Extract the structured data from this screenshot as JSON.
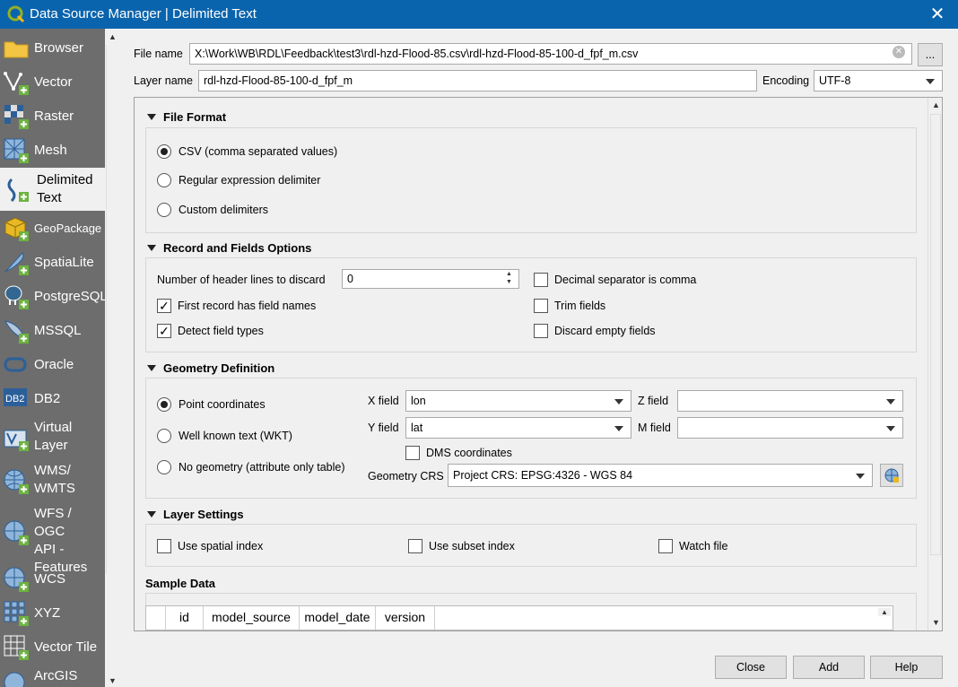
{
  "window": {
    "title": "Data Source Manager | Delimited Text"
  },
  "sidebar": {
    "items": [
      {
        "label": "Browser"
      },
      {
        "label": "Vector"
      },
      {
        "label": "Raster"
      },
      {
        "label": "Mesh"
      },
      {
        "label": "Delimited\nText"
      },
      {
        "label": "GeoPackage"
      },
      {
        "label": "SpatiaLite"
      },
      {
        "label": "PostgreSQL"
      },
      {
        "label": "MSSQL"
      },
      {
        "label": "Oracle"
      },
      {
        "label": "DB2"
      },
      {
        "label": "Virtual\nLayer"
      },
      {
        "label": "WMS/\nWMTS"
      },
      {
        "label": "WFS / OGC\nAPI -\nFeatures"
      },
      {
        "label": "WCS"
      },
      {
        "label": "XYZ"
      },
      {
        "label": "Vector Tile"
      },
      {
        "label": "ArcGIS"
      }
    ]
  },
  "file": {
    "name_label": "File name",
    "name_value": "X:\\Work\\WB\\RDL\\Feedback\\test3\\rdl-hzd-Flood-85.csv\\rdl-hzd-Flood-85-100-d_fpf_m.csv",
    "browse_label": "..."
  },
  "layer": {
    "name_label": "Layer name",
    "name_value": "rdl-hzd-Flood-85-100-d_fpf_m",
    "encoding_label": "Encoding",
    "encoding_value": "UTF-8"
  },
  "file_format": {
    "title": "File Format",
    "options": [
      "CSV (comma separated values)",
      "Regular expression delimiter",
      "Custom delimiters"
    ]
  },
  "record": {
    "title": "Record and Fields Options",
    "header_lines_label": "Number of header lines to discard",
    "header_lines_value": "0",
    "first_record": "First record has field names",
    "detect_types": "Detect field types",
    "decimal_comma": "Decimal separator is comma",
    "trim_fields": "Trim fields",
    "discard_empty": "Discard empty fields"
  },
  "geometry": {
    "title": "Geometry Definition",
    "options": [
      "Point coordinates",
      "Well known text (WKT)",
      "No geometry (attribute only table)"
    ],
    "x_label": "X field",
    "x_value": "lon",
    "y_label": "Y field",
    "y_value": "lat",
    "z_label": "Z field",
    "z_value": "",
    "m_label": "M field",
    "m_value": "",
    "dms": "DMS coordinates",
    "crs_label": "Geometry CRS",
    "crs_value": "Project CRS: EPSG:4326 - WGS 84"
  },
  "layer_settings": {
    "title": "Layer Settings",
    "spatial_index": "Use spatial index",
    "subset_index": "Use subset index",
    "watch_file": "Watch file"
  },
  "sample": {
    "title": "Sample Data",
    "columns": [
      "id",
      "model_source",
      "model_date",
      "version"
    ]
  },
  "buttons": {
    "close": "Close",
    "add": "Add",
    "help": "Help"
  }
}
